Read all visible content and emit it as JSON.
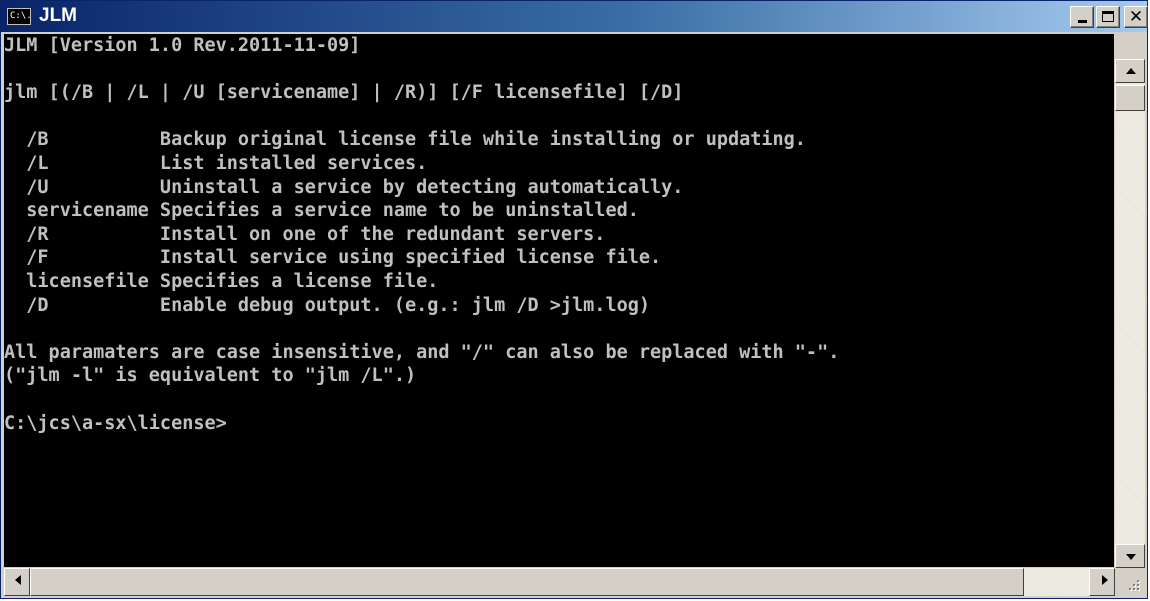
{
  "window": {
    "title": "JLM",
    "icon": "console-window-icon",
    "icon_text": "C:\\."
  },
  "console": {
    "lines": [
      "JLM [Version 1.0 Rev.2011-11-09]",
      "",
      "jlm [(/B | /L | /U [servicename] | /R)] [/F licensefile] [/D]",
      "",
      "  /B          Backup original license file while installing or updating.",
      "  /L          List installed services.",
      "  /U          Uninstall a service by detecting automatically.",
      "  servicename Specifies a service name to be uninstalled.",
      "  /R          Install on one of the redundant servers.",
      "  /F          Install service using specified license file.",
      "  licensefile Specifies a license file.",
      "  /D          Enable debug output. (e.g.: jlm /D >jlm.log)",
      "",
      "All paramaters are case insensitive, and \"/\" can also be replaced with \"-\".",
      "(\"jlm -l\" is equivalent to \"jlm /L\".)",
      "",
      "C:\\jcs\\a-sx\\license>"
    ],
    "text_color": "#c0c0c0",
    "background": "#000000"
  }
}
